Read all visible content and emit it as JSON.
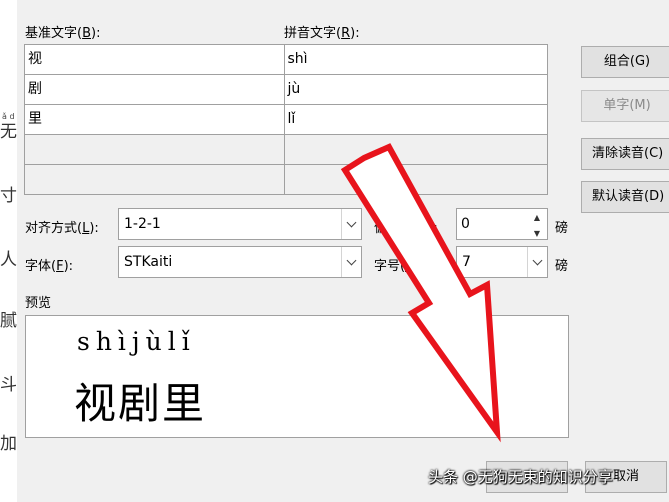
{
  "labels": {
    "base_text": "基准文字(",
    "base_key": "B",
    "base_end": "):",
    "pinyin_text": "拼音文字(",
    "pinyin_key": "R",
    "pinyin_end": "):",
    "align": "对齐方式(",
    "align_key": "L",
    "align_end": "):",
    "font": "字体(",
    "font_key": "F",
    "font_end": "):",
    "offset": "偏移量(",
    "offset_key": "O",
    "offset_end": "):",
    "size": "字号(",
    "size_key": "S",
    "size_end": "):",
    "preview": "预览",
    "unit_pt": "磅"
  },
  "rows": [
    {
      "base": "视",
      "pinyin": "shì"
    },
    {
      "base": "剧",
      "pinyin": "jù"
    },
    {
      "base": "里",
      "pinyin": "lǐ"
    },
    {
      "base": "",
      "pinyin": ""
    },
    {
      "base": "",
      "pinyin": ""
    }
  ],
  "buttons": {
    "group": "组合(G)",
    "single": "单字(M)",
    "clear": "清除读音(C)",
    "default": "默认读音(D)",
    "cancel": "取消"
  },
  "fields": {
    "alignment": "1-2-1",
    "font": "STKaiti",
    "offset": "0",
    "size": "7"
  },
  "preview": {
    "pinyin": "shìjùlǐ",
    "hanzi": "视剧里"
  },
  "watermark": "头条 @无狗无束的知识分享",
  "doc_strip": {
    "chars": [
      "无",
      "寸",
      "人",
      "腻,",
      "斗",
      "加,"
    ],
    "small": "ǎ d"
  }
}
